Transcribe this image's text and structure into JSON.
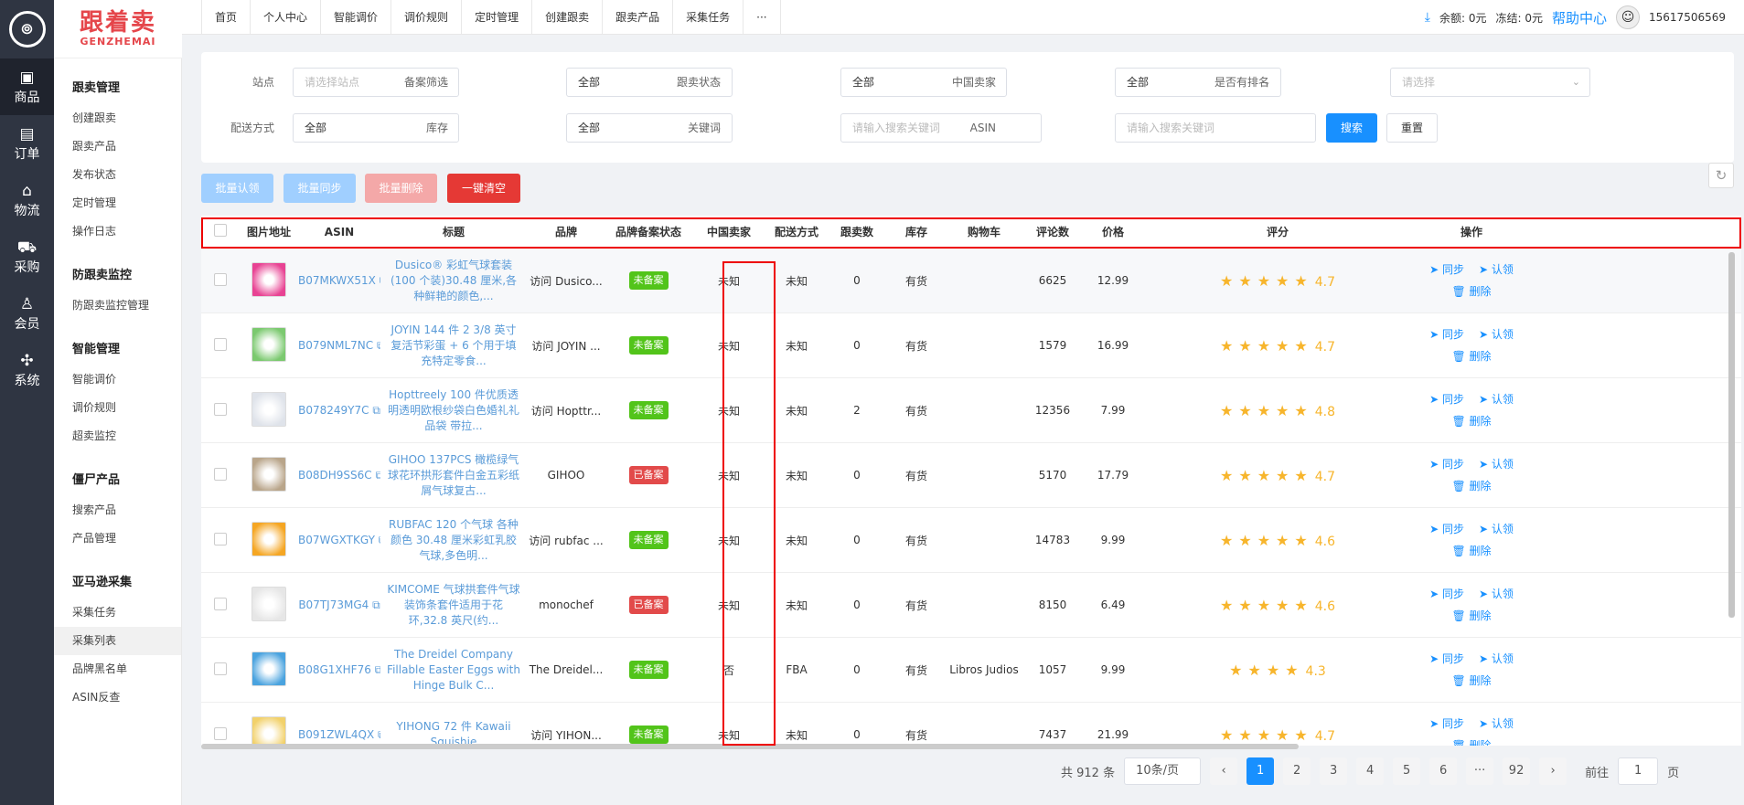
{
  "rail": {
    "items": [
      {
        "label": "商品",
        "icon": "box-icon",
        "glyph": "▣"
      },
      {
        "label": "订单",
        "icon": "order-icon",
        "glyph": "▤"
      },
      {
        "label": "物流",
        "icon": "home-icon",
        "glyph": "⌂"
      },
      {
        "label": "采购",
        "icon": "cart-icon",
        "glyph": "⛟"
      },
      {
        "label": "会员",
        "icon": "user-icon",
        "glyph": "♙"
      },
      {
        "label": "系统",
        "icon": "puzzle-icon",
        "glyph": "✣"
      }
    ]
  },
  "brand": {
    "cn": "跟着卖",
    "en": "GENZHEMAI"
  },
  "sidebar": {
    "groups": [
      {
        "title": "跟卖管理",
        "items": [
          "创建跟卖",
          "跟卖产品",
          "发布状态",
          "定时管理",
          "操作日志"
        ]
      },
      {
        "title": "防跟卖监控",
        "items": [
          "防跟卖监控管理"
        ]
      },
      {
        "title": "智能管理",
        "items": [
          "智能调价",
          "调价规则",
          "超卖监控"
        ]
      },
      {
        "title": "僵尸产品",
        "items": [
          "搜索产品",
          "产品管理"
        ]
      },
      {
        "title": "亚马逊采集",
        "items": [
          "采集任务",
          "采集列表",
          "品牌黑名单",
          "ASIN反查"
        ]
      }
    ],
    "active": "采集列表"
  },
  "topbar": {
    "tabs": [
      "首页",
      "个人中心",
      "智能调价",
      "调价规则",
      "定时管理",
      "创建跟卖",
      "跟卖产品",
      "采集任务",
      "···"
    ],
    "balance": "余额: 0元",
    "frozen": "冻结: 0元",
    "help": "帮助中心",
    "phone": "15617506569"
  },
  "filters": {
    "site_label": "站点",
    "site_ph": "请选择站点",
    "record_label": "备案筛选",
    "record_val": "全部",
    "follow_label": "跟卖状态",
    "follow_val": "全部",
    "cnseller_label": "中国卖家",
    "cnseller_val": "全部",
    "rank_label": "是否有排名",
    "rank_ph": "请选择",
    "ship_label": "配送方式",
    "ship_val": "全部",
    "stock_label": "库存",
    "stock_val": "全部",
    "kw_label": "关键词",
    "kw_ph": "请输入搜索关键词",
    "asin_label": "ASIN",
    "asin_ph": "请输入搜索关键词",
    "search": "搜索",
    "reset": "重置"
  },
  "bulk": {
    "claim": "批量认领",
    "sync": "批量同步",
    "delete": "批量删除",
    "clear": "一键清空"
  },
  "columns": [
    "图片地址",
    "ASIN",
    "标题",
    "品牌",
    "品牌备案状态",
    "中国卖家",
    "配送方式",
    "跟卖数",
    "库存",
    "购物车",
    "评论数",
    "价格",
    "评分",
    "操作"
  ],
  "rows": [
    {
      "asin": "B07MKWX51X",
      "title": "Dusico® 彩虹气球套装(100 个装)30.48 厘米,各种鲜艳的颜色,...",
      "brand": "访问 Dusico...",
      "status": "未备案",
      "cn": "未知",
      "ship": "未知",
      "follow": "0",
      "stock": "有货",
      "cart": "",
      "reviews": "6625",
      "price": "12.99",
      "rating": "4.7",
      "thumb": "#e84393"
    },
    {
      "asin": "B079NML7NC",
      "title": "JOYIN 144 件 2 3/8 英寸复活节彩蛋 + 6 个用于填充特定零食...",
      "brand": "访问 JOYIN ...",
      "status": "未备案",
      "cn": "未知",
      "ship": "未知",
      "follow": "0",
      "stock": "有货",
      "cart": "",
      "reviews": "1579",
      "price": "16.99",
      "rating": "4.7",
      "thumb": "#7bc96f"
    },
    {
      "asin": "B078249Y7C",
      "title": "Hopttreely 100 件优质透明透明欧根纱袋白色婚礼礼品袋 带拉...",
      "brand": "访问 Hopttr...",
      "status": "未备案",
      "cn": "未知",
      "ship": "未知",
      "follow": "2",
      "stock": "有货",
      "cart": "",
      "reviews": "12356",
      "price": "7.99",
      "rating": "4.8",
      "thumb": "#dfe3ea"
    },
    {
      "asin": "B08DH9SS6C",
      "title": "GIHOO 137PCS 橄榄绿气球花环拱形套件白金五彩纸屑气球复古...",
      "brand": "GIHOO",
      "status": "已备案",
      "cn": "未知",
      "ship": "未知",
      "follow": "0",
      "stock": "有货",
      "cart": "",
      "reviews": "5170",
      "price": "17.79",
      "rating": "4.7",
      "thumb": "#b9a58a"
    },
    {
      "asin": "B07WGXTKGY",
      "title": "RUBFAC 120 个气球 各种颜色 30.48 厘米彩虹乳胶气球,多色明...",
      "brand": "访问 rubfac ...",
      "status": "未备案",
      "cn": "未知",
      "ship": "未知",
      "follow": "0",
      "stock": "有货",
      "cart": "",
      "reviews": "14783",
      "price": "9.99",
      "rating": "4.6",
      "thumb": "#f5a623"
    },
    {
      "asin": "B07TJ73MG4",
      "title": "KIMCOME 气球拱套件气球装饰条套件适用于花环,32.8 英尺(约...",
      "brand": "monochef",
      "status": "已备案",
      "cn": "未知",
      "ship": "未知",
      "follow": "0",
      "stock": "有货",
      "cart": "",
      "reviews": "8150",
      "price": "6.49",
      "rating": "4.6",
      "thumb": "#e6e6e6"
    },
    {
      "asin": "B08G1XHF76",
      "title": "The Dreidel Company Fillable Easter Eggs with Hinge Bulk C...",
      "brand": "The Dreidel...",
      "status": "未备案",
      "cn": "否",
      "ship": "FBA",
      "follow": "0",
      "stock": "有货",
      "cart": "Libros Judios",
      "reviews": "1057",
      "price": "9.99",
      "rating": "4.3",
      "thumb": "#4aa3df"
    },
    {
      "asin": "B091ZWL4QX",
      "title": "YIHONG 72 件 Kawaii Squishie",
      "brand": "访问 YIHON...",
      "status": "未备案",
      "cn": "未知",
      "ship": "未知",
      "follow": "0",
      "stock": "有货",
      "cart": "",
      "reviews": "7437",
      "price": "21.99",
      "rating": "4.7",
      "thumb": "#f2d16b"
    }
  ],
  "actions": {
    "sync": "同步",
    "claim": "认领",
    "delete": "删除"
  },
  "pager": {
    "total": "共 912 条",
    "per": "10条/页",
    "pages": [
      "1",
      "2",
      "3",
      "4",
      "5",
      "6",
      "···",
      "92"
    ],
    "goto": "前往",
    "page_val": "1",
    "page_suffix": "页"
  }
}
